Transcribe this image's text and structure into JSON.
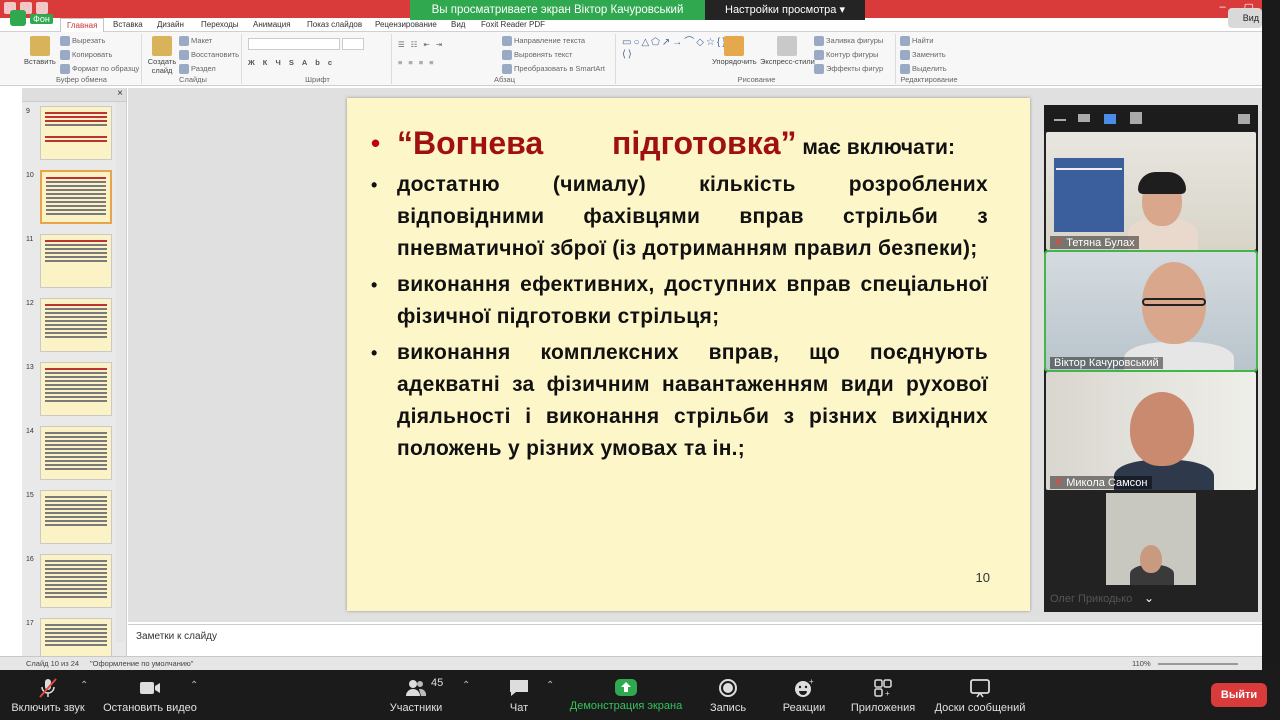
{
  "zoom_banner": {
    "viewing_text": "Вы просматриваете экран Віктор Качуровський",
    "view_options": "Настройки просмотра ▾"
  },
  "zoom_corner": {
    "shield_label": "Фон",
    "view_label": "Вид"
  },
  "ppt": {
    "tabs": [
      "Главная",
      "Вставка",
      "Дизайн",
      "Переходы",
      "Анимация",
      "Показ слайдов",
      "Рецензирование",
      "Вид",
      "Foxit Reader PDF"
    ],
    "ribbon": {
      "clipboard": {
        "paste": "Вставить",
        "cut": "Вырезать",
        "copy": "Копировать",
        "format": "Формат по образцу",
        "label": "Буфер обмена"
      },
      "slides": {
        "create": "Создать слайд",
        "layout": "Макет",
        "restore": "Восстановить",
        "section": "Раздел",
        "label": "Слайды"
      },
      "font": {
        "label": "Шрифт"
      },
      "paragraph": {
        "direction": "Направление текста",
        "align": "Выровнять текст",
        "smartart": "Преобразовать в SmartArt",
        "label": "Абзац"
      },
      "drawing": {
        "arrange": "Упорядочить",
        "styles": "Экспресс-стили",
        "fill": "Заливка фигуры",
        "outline": "Контур фигуры",
        "effects": "Эффекты фигур",
        "label": "Рисование"
      },
      "editing": {
        "find": "Найти",
        "replace": "Заменить",
        "select": "Выделить",
        "label": "Редактирование"
      }
    },
    "thumbnails": [
      {
        "num": "9"
      },
      {
        "num": "10"
      },
      {
        "num": "11"
      },
      {
        "num": "12"
      },
      {
        "num": "13"
      },
      {
        "num": "14"
      },
      {
        "num": "15"
      },
      {
        "num": "16"
      },
      {
        "num": "17"
      }
    ],
    "slide": {
      "title_quote": "“Вогнева підготовка”",
      "title_rest": "має включати:",
      "bullets": [
        "достатню (чималу) кількість розроблених відповідними фахівцями вправ стрільби з пневматичної зброї (із дотриманням правил безпеки);",
        "виконання ефективних, доступних вправ спеціальної фізичної підготовки стрільця;",
        "виконання комплексних вправ, що поєднують адекватні за фізичним навантаженням види рухової діяльності і виконання стрільби з різних вихідних положень у різних умовах та ін.;"
      ],
      "number": "10"
    },
    "notes_placeholder": "Заметки к слайду",
    "status": {
      "slide_info": "Слайд 10 из 24",
      "theme": "\"Оформление по умолчанию\"",
      "zoom": "110%"
    }
  },
  "participants": [
    {
      "name": "Тетяна Булах",
      "muted": true
    },
    {
      "name": "Віктор Качуровський",
      "muted": false
    },
    {
      "name": "Микола Самсон",
      "muted": true
    },
    {
      "name": "Олег Прикодько",
      "muted": false
    }
  ],
  "toolbar": {
    "unmute": "Включить звук",
    "stop_video": "Остановить видео",
    "participants": "Участники",
    "participants_count": "45",
    "chat": "Чат",
    "share": "Демонстрация экрана",
    "record": "Запись",
    "reactions": "Реакции",
    "apps": "Приложения",
    "whiteboard": "Доски сообщений",
    "leave": "Выйти"
  },
  "colors": {
    "zoom_green": "#2fa84f",
    "ppt_red": "#d93a3a",
    "slide_bg": "#fdf6c9",
    "title_red": "#a01010"
  }
}
